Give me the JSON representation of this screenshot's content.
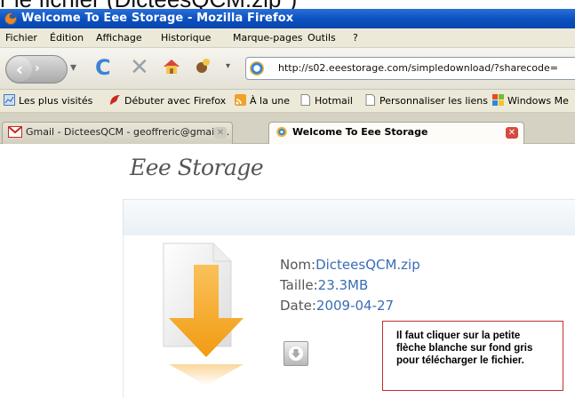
{
  "caption": "r le fichier (DicteesQCM.zip\")",
  "window": {
    "title": "Welcome To Eee Storage - Mozilla Firefox"
  },
  "menu": {
    "items": [
      "Fichier",
      "Édition",
      "Affichage",
      "Historique",
      "Marque-pages",
      "Outils",
      "?"
    ]
  },
  "navbar": {
    "url": "http://s02.eeestorage.com/simpledownload/?sharecode="
  },
  "bookmarks": {
    "items": [
      "Les plus visités",
      "Débuter avec Firefox",
      "À la une",
      "Hotmail",
      "Personnaliser les liens",
      "Windows Me"
    ]
  },
  "tabs": [
    {
      "label": "Gmail - DicteesQCM - geoffreric@gmail....",
      "active": false
    },
    {
      "label": "Welcome To Eee Storage",
      "active": true
    }
  ],
  "page": {
    "logo": "Eee Storage",
    "file": {
      "name_label": "Nom:",
      "name_value": "DicteesQCM.zip",
      "size_label": "Taille:",
      "size_value": "23.3MB",
      "date_label": "Date:",
      "date_value": "2009-04-27"
    },
    "note": "Il faut cliquer sur la petite flèche blanche sur fond gris pour télécharger le fichier."
  },
  "colors": {
    "titlebar": "#0a4fc0",
    "note_border": "#c0312b",
    "value_text": "#3a6db4",
    "arrow_orange": "#f5a623"
  }
}
